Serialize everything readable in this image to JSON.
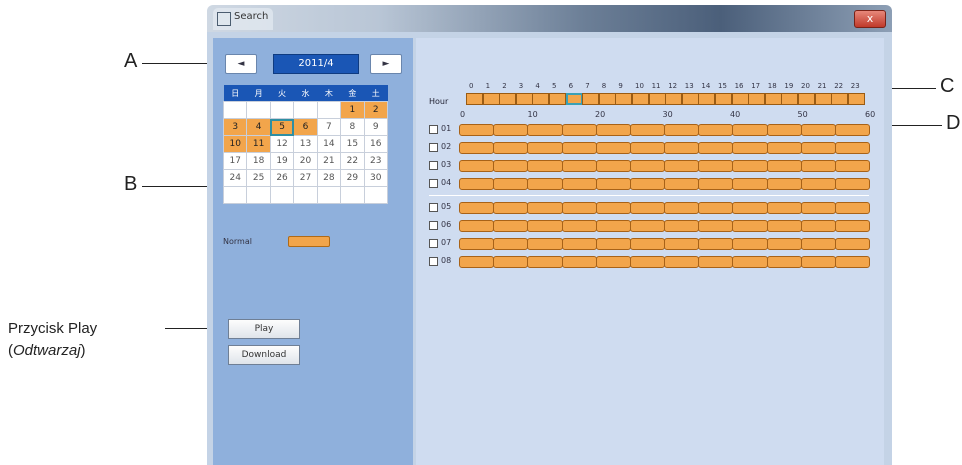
{
  "callouts": {
    "a": "A",
    "b": "B",
    "c": "C",
    "d": "D",
    "play_caption_1": "Przycisk Play",
    "play_caption_paren_open": "(",
    "play_caption_italic": "Odtwarzaj",
    "play_caption_paren_close": ")"
  },
  "window": {
    "title": "Search",
    "close_label": "x"
  },
  "calendar": {
    "prev_label": "◄",
    "next_label": "►",
    "month_label": "2011/4",
    "weekday_headers": [
      "日",
      "月",
      "火",
      "水",
      "木",
      "金",
      "土"
    ],
    "weeks": [
      [
        "",
        "",
        "",
        "",
        "",
        "1",
        "2"
      ],
      [
        "3",
        "4",
        "5",
        "6",
        "7",
        "8",
        "9"
      ],
      [
        "10",
        "11",
        "12",
        "13",
        "14",
        "15",
        "16"
      ],
      [
        "17",
        "18",
        "19",
        "20",
        "21",
        "22",
        "23"
      ],
      [
        "24",
        "25",
        "26",
        "27",
        "28",
        "29",
        "30"
      ],
      [
        "",
        "",
        "",
        "",
        "",
        "",
        ""
      ]
    ],
    "recorded_days": [
      "1",
      "2",
      "3",
      "4",
      "5",
      "6",
      "10",
      "11"
    ],
    "selected_day": "5",
    "legend_label": "Normal",
    "record_color": "#f2a54b"
  },
  "buttons": {
    "play": "Play",
    "download": "Download"
  },
  "timeline": {
    "hour_label": "Hour",
    "hours": [
      "0",
      "1",
      "2",
      "3",
      "4",
      "5",
      "6",
      "7",
      "8",
      "9",
      "10",
      "11",
      "12",
      "13",
      "14",
      "15",
      "16",
      "17",
      "18",
      "19",
      "20",
      "21",
      "22",
      "23"
    ],
    "selected_hour": "6",
    "minute_ticks": [
      "0",
      "10",
      "20",
      "30",
      "40",
      "50",
      "60"
    ],
    "cameras": [
      "01",
      "02",
      "03",
      "04",
      "05",
      "06",
      "07",
      "08"
    ]
  }
}
